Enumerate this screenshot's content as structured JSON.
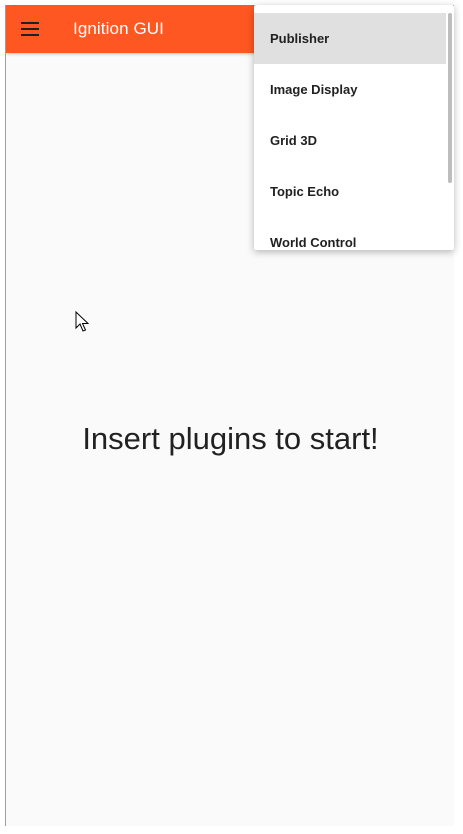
{
  "app": {
    "title": "Ignition GUI",
    "accent_color": "#ff5722"
  },
  "toolbar": {
    "menu_icon": "hamburger-menu-icon"
  },
  "main": {
    "placeholder_text": "Insert plugins to start!"
  },
  "plugin_menu": {
    "items": [
      {
        "label": "Publisher",
        "highlighted": true
      },
      {
        "label": "Image Display",
        "highlighted": false
      },
      {
        "label": "Grid 3D",
        "highlighted": false
      },
      {
        "label": "Topic Echo",
        "highlighted": false
      },
      {
        "label": "World Control",
        "highlighted": false
      }
    ]
  }
}
